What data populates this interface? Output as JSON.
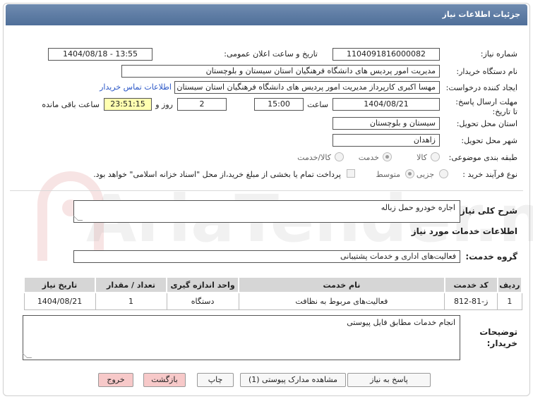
{
  "header": {
    "title": "جزئیات اطلاعات نیاز"
  },
  "form": {
    "need_number_label": "شماره نیاز:",
    "need_number": "1104091816000082",
    "announce_label": "تاریخ و ساعت اعلان عمومی:",
    "announce_value": "1404/08/18 - 13:55",
    "buyer_org_label": "نام دستگاه خریدار:",
    "buyer_org": "مدیریت امور پردیس های دانشگاه فرهنگیان استان سیستان و بلوچستان",
    "creator_label": "ایجاد کننده درخواست:",
    "creator": "مهسا اکبری کارپرداز مدیریت امور پردیس های دانشگاه فرهنگیان استان سیستان",
    "contact_link": "اطلاعات تماس خریدار",
    "deadline_label": "مهلت ارسال پاسخ: تا تاریخ:",
    "deadline_date": "1404/08/21",
    "time_label": "ساعت",
    "deadline_time": "15:00",
    "days_value": "2",
    "days_label": "روز و",
    "remaining_time": "23:51:15",
    "remaining_label": "ساعت باقی مانده",
    "province_label": "استان محل تحویل:",
    "province": "سیستان و بلوچستان",
    "city_label": "شهر محل تحویل:",
    "city": "زاهدان",
    "category_label": "طبقه بندی موضوعی:",
    "category_options": [
      "کالا",
      "خدمت",
      "کالا/خدمت"
    ],
    "category_selected": "خدمت",
    "process_label": "نوع فرآیند خرید :",
    "process_options": [
      "جزیی",
      "متوسط"
    ],
    "process_selected": "متوسط",
    "payment_note": "پرداخت تمام یا بخشی از مبلغ خرید،از محل \"اسناد خزانه اسلامی\" خواهد بود."
  },
  "summary": {
    "label": "شرح کلی نیاز:",
    "value": "اجاره خودرو حمل زباله"
  },
  "services_section": {
    "title": "اطلاعات خدمات مورد نیاز",
    "group_label": "گروه خدمت:",
    "group_value": "فعالیت‌های اداری و خدمات پشتیبانی"
  },
  "table": {
    "headers": [
      "ردیف",
      "کد خدمت",
      "نام خدمت",
      "واحد اندازه گیری",
      "تعداد / مقدار",
      "تاریخ نیاز"
    ],
    "rows": [
      [
        "1",
        "ز-81-812",
        "فعالیت‌های مربوط به نظافت",
        "دستگاه",
        "1",
        "1404/08/21"
      ]
    ]
  },
  "notes": {
    "label": "توضیحات خریدار:",
    "value": "انجام خدمات مطابق فایل پیوستی"
  },
  "buttons": {
    "reply": "پاسخ به نیاز",
    "attachments": "مشاهده مدارک پیوستی (1)",
    "print": "چاپ",
    "back": "بازگشت",
    "exit": "خروج"
  },
  "watermark": {
    "text": "AriaTender.net"
  }
}
